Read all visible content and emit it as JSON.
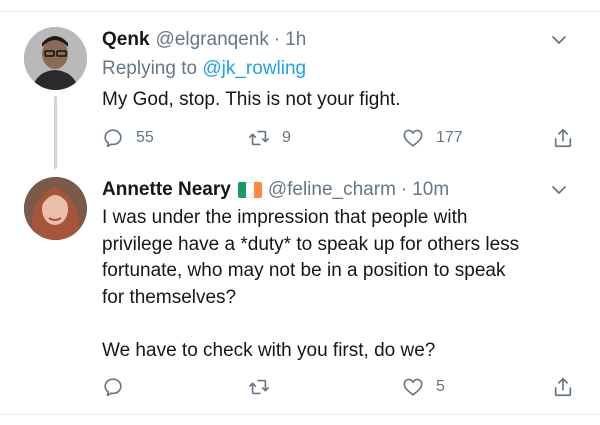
{
  "tweets": [
    {
      "name": "Qenk",
      "handle": "@elgranqenk",
      "separator": "·",
      "time": "1h",
      "replying_prefix": "Replying to ",
      "replying_to": "@jk_rowling",
      "text": "My God, stop. This is not your fight.",
      "counts": {
        "replies": "55",
        "retweets": "9",
        "likes": "177"
      }
    },
    {
      "name": "Annette Neary",
      "flag_colors": [
        "#169b62",
        "#ffffff",
        "#ff883e"
      ],
      "handle": "@feline_charm",
      "separator": "·",
      "time": "10m",
      "text": "I was under the impression that people with\nprivilege have a *duty* to speak up for others less\nfortunate, who may not be in a position to speak\nfor themselves?\n\nWe have to check with you first, do we?",
      "counts": {
        "replies": "",
        "retweets": "",
        "likes": "5"
      }
    }
  ],
  "colors": {
    "text": "#14171a",
    "secondary": "#657786",
    "link": "#1da1f2",
    "divider": "#e6ecf0"
  },
  "icons": [
    "reply-icon",
    "retweet-icon",
    "like-icon",
    "share-icon",
    "chevron-down-icon"
  ]
}
